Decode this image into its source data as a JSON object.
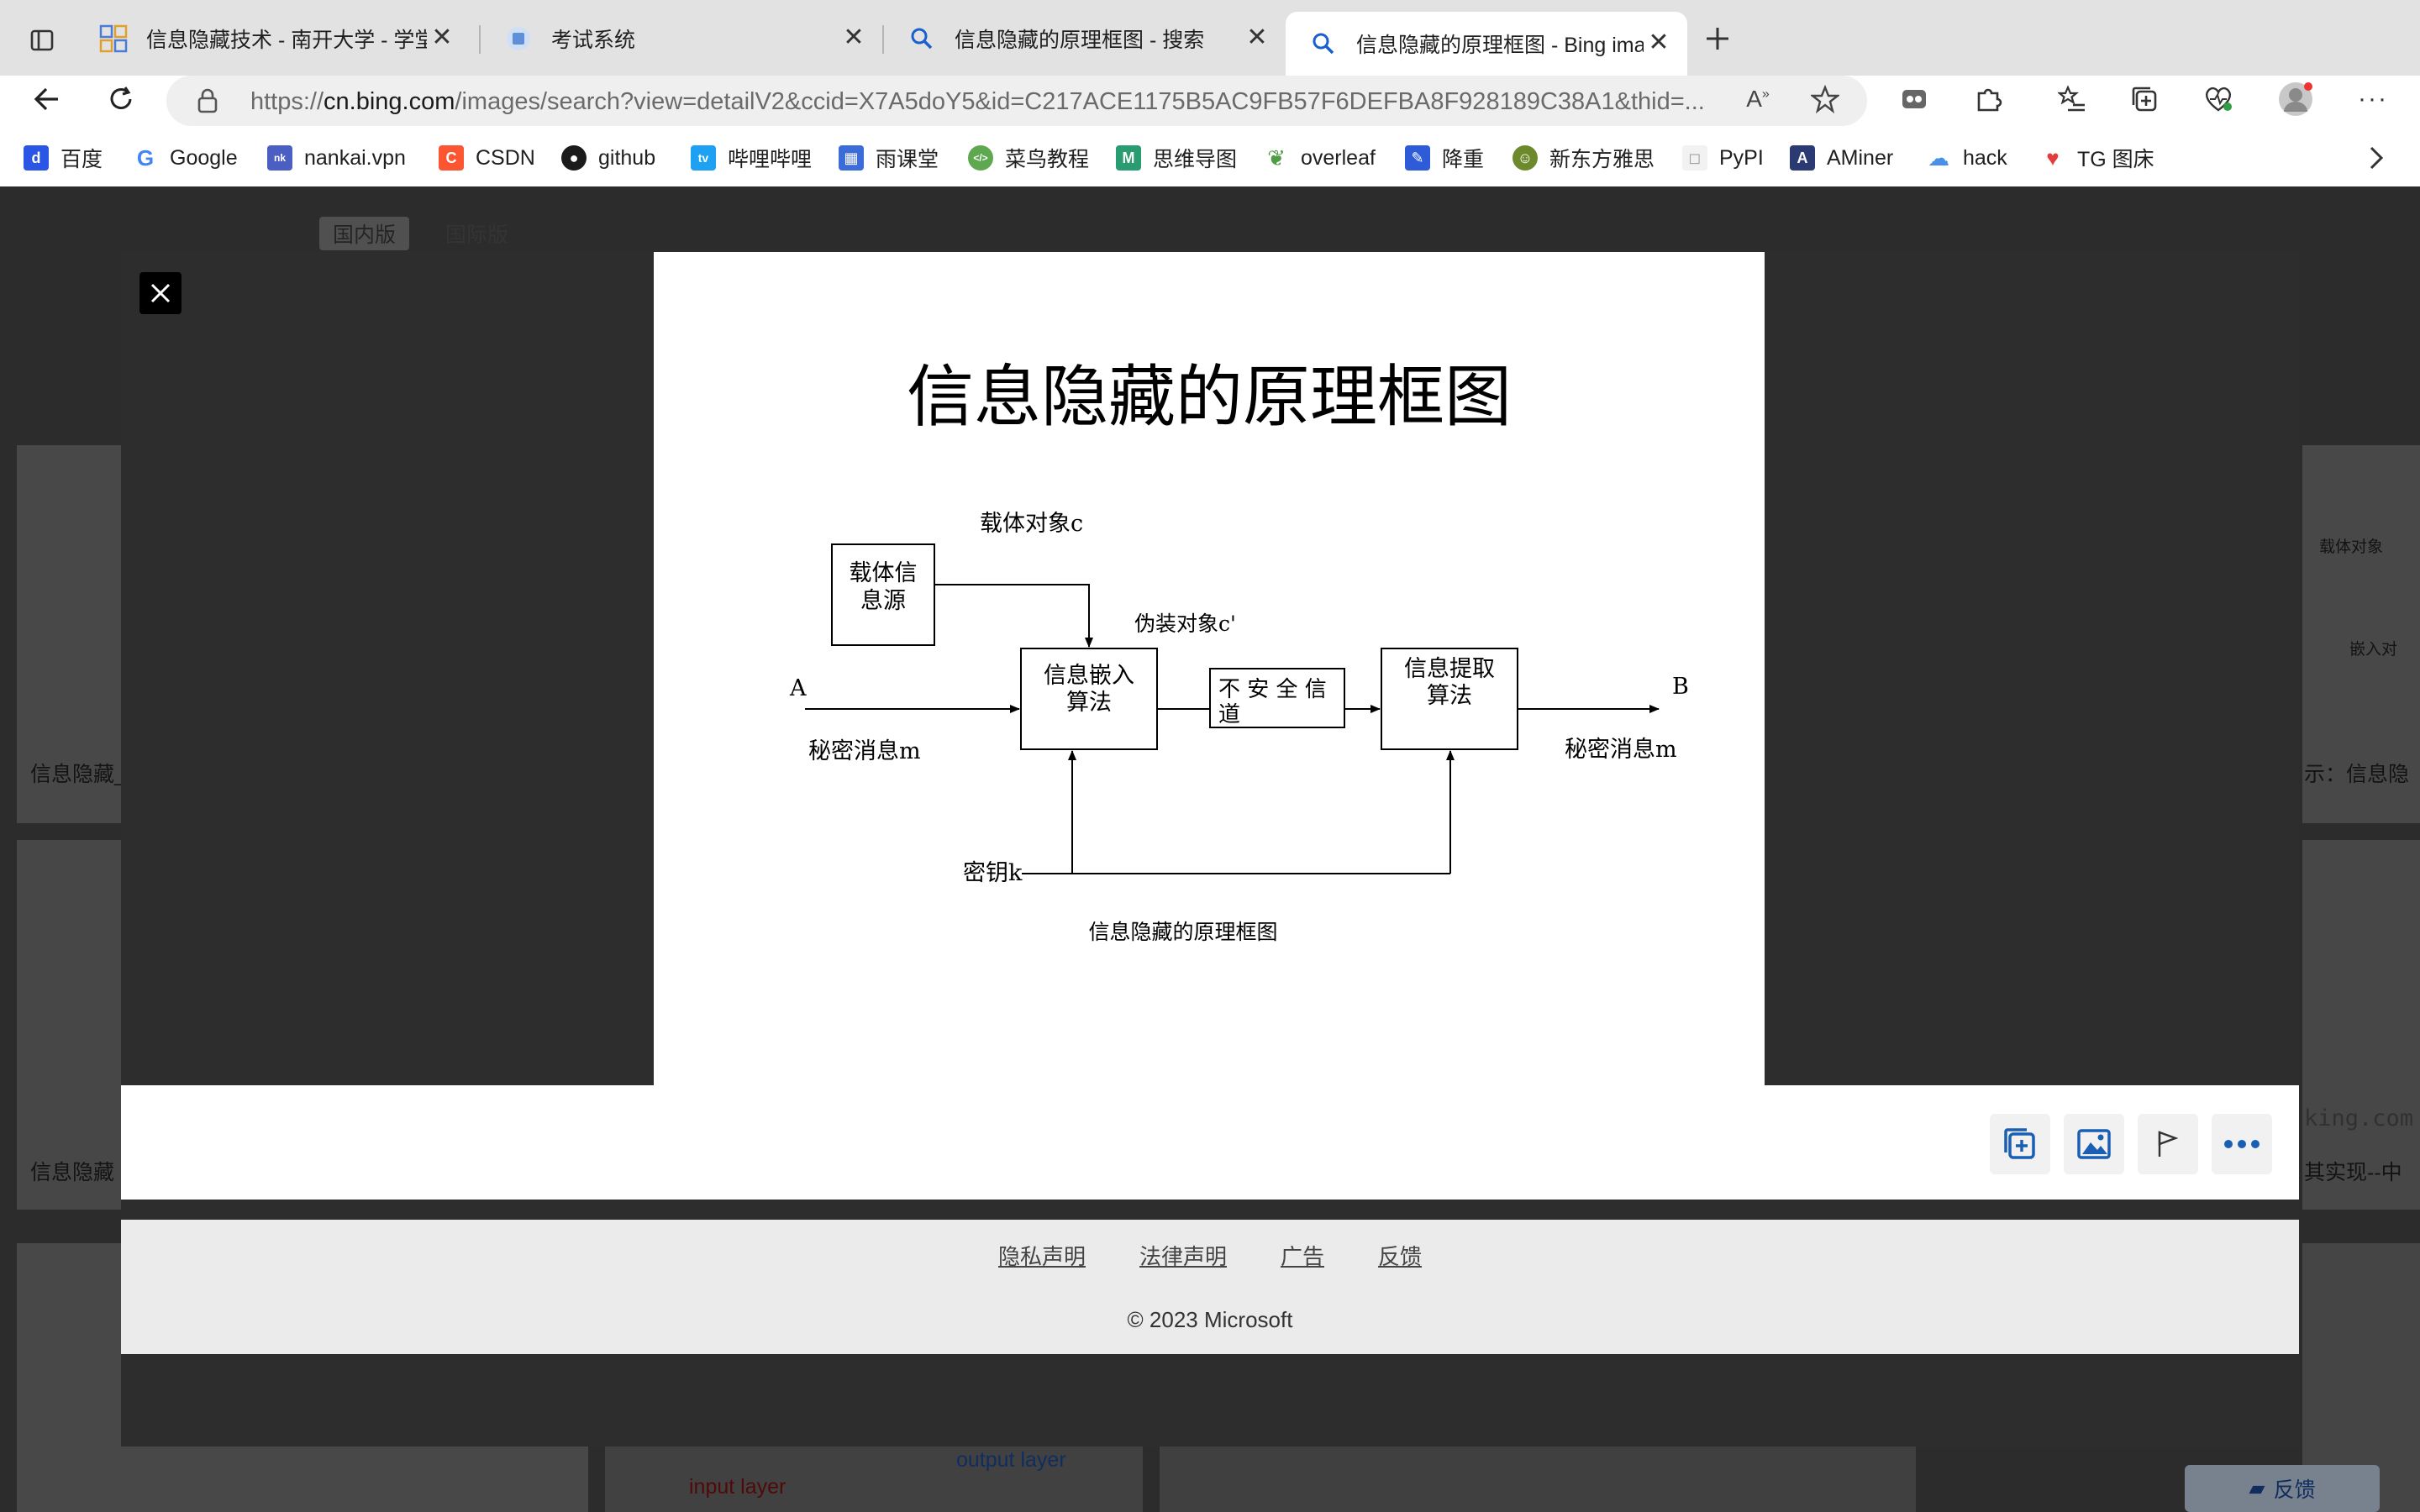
{
  "tabs": [
    {
      "title": "信息隐藏技术 - 南开大学 - 学堂在线",
      "active": false
    },
    {
      "title": "考试系统",
      "active": false
    },
    {
      "title": "信息隐藏的原理框图 - 搜索",
      "active": false
    },
    {
      "title": "信息隐藏的原理框图 - Bing images",
      "active": true
    }
  ],
  "address": {
    "prefix": "https://",
    "host": "cn.bing.com",
    "path": "/images/search?view=detailV2&ccid=X7A5doY5&id=C217ACE1175B5AC9FB57F6DEFBA8F928189C38A1&thid=..."
  },
  "bookmarks": [
    {
      "label": "百度",
      "icon": "baidu-icon",
      "color": "#2b56e5"
    },
    {
      "label": "Google",
      "icon": "google-icon",
      "color": "#4285f4"
    },
    {
      "label": "nankai.vpn",
      "icon": "nankai-icon",
      "color": "#4a5fc1"
    },
    {
      "label": "CSDN",
      "icon": "csdn-icon",
      "color": "#fc5531"
    },
    {
      "label": "github",
      "icon": "github-icon",
      "color": "#1b1b1b"
    },
    {
      "label": "哔哩哔哩",
      "icon": "bilibili-icon",
      "color": "#1ea1f2"
    },
    {
      "label": "雨课堂",
      "icon": "yuketang-icon",
      "color": "#3c6cd7"
    },
    {
      "label": "菜鸟教程",
      "icon": "runoob-icon",
      "color": "#5ea84f"
    },
    {
      "label": "思维导图",
      "icon": "mindmap-icon",
      "color": "#2a9c72"
    },
    {
      "label": "overleaf",
      "icon": "overleaf-icon",
      "color": "#4f9c45"
    },
    {
      "label": "降重",
      "icon": "pen-icon",
      "color": "#2e5bd8"
    },
    {
      "label": "新东方雅思",
      "icon": "xdf-icon",
      "color": "#6c8a2c"
    },
    {
      "label": "PyPI",
      "icon": "pypi-icon",
      "color": "#f2f2f2"
    },
    {
      "label": "AMiner",
      "icon": "aminer-icon",
      "color": "#2c3a74"
    },
    {
      "label": "hack",
      "icon": "cloud-icon",
      "color": "#4a8fe8"
    },
    {
      "label": "TG 图床",
      "icon": "heart-icon",
      "color": "#e23c3c"
    }
  ],
  "page": {
    "scope_tabs": [
      "国内版",
      "国际版"
    ],
    "bg_left_captions": [
      "信息隐藏_",
      "信息隐藏 -"
    ],
    "bg_right_captions": [
      "示：信息隐",
      "其实现--中"
    ],
    "bg_right_labels": [
      "载体对象",
      "嵌入对"
    ],
    "bg_output_layer": "output layer",
    "bg_input_layer": "input layer",
    "bg_watermark": "king.com",
    "feedback_button": "反馈"
  },
  "figure": {
    "title": "信息隐藏的原理框图",
    "caption": "信息隐藏的原理框图",
    "labels": {
      "carrier_source": [
        "载体信",
        "息源"
      ],
      "carrier_object": "载体对象c",
      "embed_algo": [
        "信息嵌入",
        "算法"
      ],
      "disguised_object": "伪装对象c'",
      "channel": [
        "不 安 全 信",
        "道"
      ],
      "extract_algo": [
        "信息提取",
        "算法"
      ],
      "point_a": "A",
      "point_b": "B",
      "secret_in": "秘密消息m",
      "secret_out": "秘密消息m",
      "key": "密钥k"
    }
  },
  "footer": {
    "links": [
      "隐私声明",
      "法律声明",
      "广告",
      "反馈"
    ],
    "copyright": "© 2023 Microsoft"
  }
}
